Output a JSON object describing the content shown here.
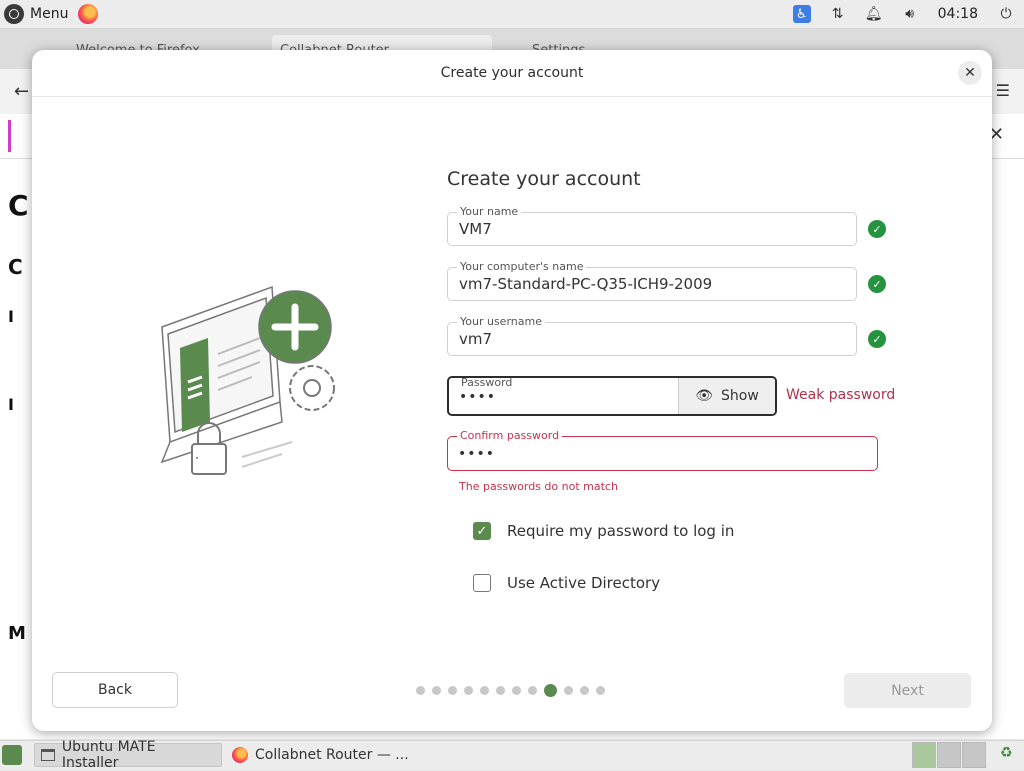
{
  "top_panel": {
    "menu_label": "Menu",
    "clock": "04:18"
  },
  "browser_bg": {
    "tabs": [
      "Welcome to Firefox",
      "Collabnet Router",
      "Settings"
    ]
  },
  "dialog": {
    "window_title": "Create your account",
    "form_title": "Create your account",
    "name": {
      "label": "Your name",
      "value": "VM7"
    },
    "computer_name": {
      "label": "Your computer's name",
      "value": "vm7-Standard-PC-Q35-ICH9-2009"
    },
    "username": {
      "label": "Your username",
      "value": "vm7"
    },
    "password": {
      "label": "Password",
      "value": "••••",
      "show_label": "Show",
      "strength": "Weak password"
    },
    "confirm_password": {
      "label": "Confirm password",
      "value": "••••",
      "error": "The passwords do not match"
    },
    "require_password": {
      "label": "Require my password to log in",
      "checked": true
    },
    "active_directory": {
      "label": "Use Active Directory",
      "checked": false
    },
    "back_label": "Back",
    "next_label": "Next",
    "progress": {
      "total_steps": 12,
      "current_step": 9
    }
  },
  "taskbar": {
    "tasks": [
      {
        "label": "Ubuntu MATE Installer",
        "icon": "window-icon"
      },
      {
        "label": "Collabnet Router — ...",
        "icon": "firefox-icon"
      }
    ]
  },
  "colors": {
    "accent": "#5b8a4f",
    "success": "#26943e",
    "error": "#c7334c"
  }
}
